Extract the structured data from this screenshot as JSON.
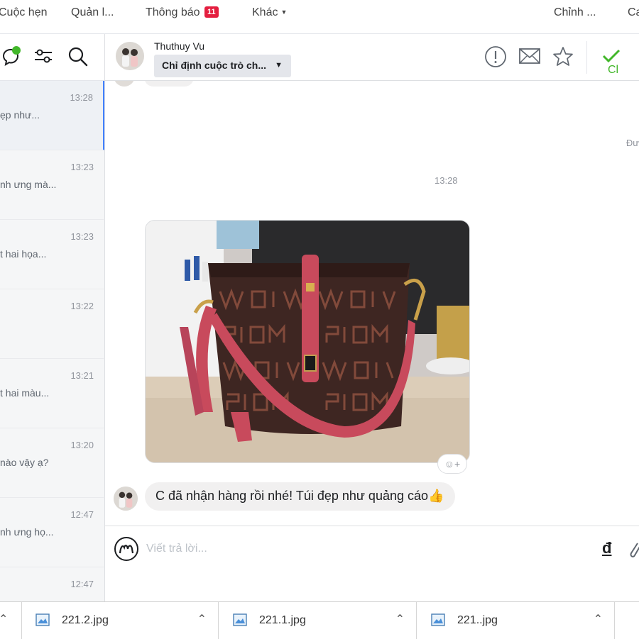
{
  "topnav": {
    "items": [
      "Cuộc hẹn",
      "Quản l...",
      "Thông báo",
      "Khác",
      "Chỉnh ...",
      "Ca"
    ],
    "notification_count": "11"
  },
  "conversations": [
    {
      "time": "13:28",
      "snippet": "ẹp như..."
    },
    {
      "time": "13:23",
      "snippet": "nh ưng mà..."
    },
    {
      "time": "13:23",
      "snippet": "t hai họa..."
    },
    {
      "time": "13:22",
      "snippet": ""
    },
    {
      "time": "13:21",
      "snippet": "t hai màu..."
    },
    {
      "time": "13:20",
      "snippet": "nào vậy ạ?"
    },
    {
      "time": "12:47",
      "snippet": "nh ưng họ..."
    },
    {
      "time": "12:47",
      "snippet": ""
    }
  ],
  "header": {
    "name": "Thuthuy Vu",
    "assign_label": "Chỉ định cuộc trò ch...",
    "done_label": "Cl"
  },
  "chat": {
    "seen_label": "Đư",
    "timestamp": "13:28",
    "message": "C đã nhận hàng rồi nhé! Túi đẹp như quảng cáo👍"
  },
  "composer": {
    "placeholder": "Viết trả lời...",
    "currency_symbol": "đ"
  },
  "downloads": [
    {
      "name": "221.2.jpg"
    },
    {
      "name": "221.1.jpg"
    },
    {
      "name": "221..jpg"
    }
  ],
  "colors": {
    "accent": "#4080ff",
    "badge": "#e41e3f",
    "done_check": "#42b72a",
    "bubble": "#f1f0f0"
  }
}
